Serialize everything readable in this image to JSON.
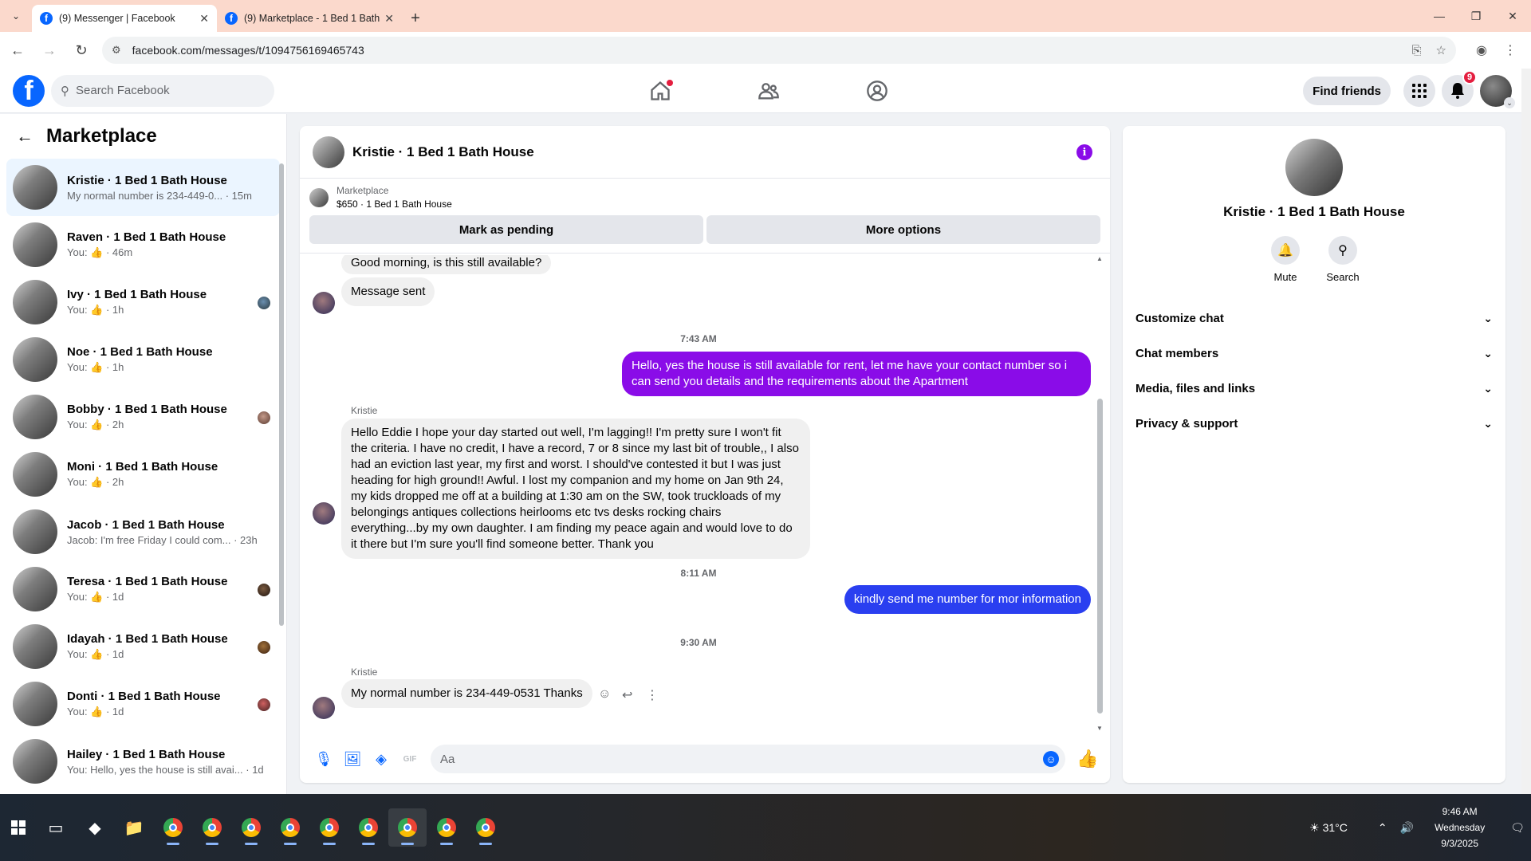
{
  "browser": {
    "tabs": [
      {
        "title": "(9) Messenger | Facebook",
        "active": true
      },
      {
        "title": "(9) Marketplace - 1 Bed 1 Bath",
        "active": false
      }
    ],
    "url": "facebook.com/messages/t/1094756169465743"
  },
  "fb": {
    "search_placeholder": "Search Facebook",
    "find_friends": "Find friends",
    "notif_count": "9"
  },
  "sidebar": {
    "title": "Marketplace",
    "conversations": [
      {
        "name": "Kristie · 1 Bed 1 Bath House",
        "preview": "My normal number is 234-449-0... · 15m",
        "active": true
      },
      {
        "name": "Raven · 1 Bed 1 Bath House",
        "you": "You: ",
        "suffix": " · 46m"
      },
      {
        "name": "Ivy · 1 Bed 1 Bath House",
        "you": "You: ",
        "suffix": " · 1h"
      },
      {
        "name": "Noe · 1 Bed 1 Bath House",
        "you": "You: ",
        "suffix": " · 1h"
      },
      {
        "name": "Bobby · 1 Bed 1 Bath House",
        "you": "You: ",
        "suffix": " · 2h"
      },
      {
        "name": "Moni · 1 Bed 1 Bath House",
        "you": "You: ",
        "suffix": " · 2h"
      },
      {
        "name": "Jacob · 1 Bed 1 Bath House",
        "preview": "Jacob: I'm free Friday I could com... · 23h"
      },
      {
        "name": "Teresa · 1 Bed 1 Bath House",
        "you": "You: ",
        "suffix": " · 1d"
      },
      {
        "name": "Idayah · 1 Bed 1 Bath House",
        "you": "You: ",
        "suffix": " · 1d"
      },
      {
        "name": "Donti · 1 Bed 1 Bath House",
        "you": "You: ",
        "suffix": " · 1d"
      },
      {
        "name": "Hailey · 1 Bed 1 Bath House",
        "preview": "You: Hello, yes the house is still avai... · 1d"
      }
    ]
  },
  "chat": {
    "title": "Kristie · 1 Bed 1 Bath House",
    "marketplace_label": "Marketplace",
    "listing": "$650 · 1 Bed 1 Bath House",
    "mark_pending": "Mark as pending",
    "more_options": "More options",
    "messages": {
      "m1": "Good morning, is this still available?",
      "m2": "Message sent",
      "ts1": "7:43 AM",
      "m3": "Hello, yes the house is still available for rent, let me have your contact number so i can send you details and the requirements about the  Apartment",
      "sender1": "Kristie",
      "m4": "Hello Eddie I hope your day started out well, I'm lagging!! I'm pretty sure I won't fit the criteria. I have no credit, I have a record, 7 or 8 since my last bit of trouble,, I also had an eviction last year, my first and worst. I should've contested it but I was just heading for high ground!! Awful. I lost my companion and my home on Jan 9th 24, my kids dropped me off at a building at 1:30 am on the SW, took truckloads of my belongings antiques collections heirlooms etc tvs desks rocking chairs everything...by my own daughter. I am finding my peace again and would love to do it there but I'm sure you'll find someone better. Thank you",
      "ts2": "8:11 AM",
      "m5": "kindly send me number for mor information",
      "ts3": "9:30 AM",
      "sender2": "Kristie",
      "m6": "My normal number is 234-449-0531 Thanks"
    },
    "composer_placeholder": "Aa"
  },
  "info": {
    "name": "Kristie · 1 Bed 1 Bath House",
    "mute": "Mute",
    "search": "Search",
    "sections": [
      "Customize chat",
      "Chat members",
      "Media, files and links",
      "Privacy & support"
    ]
  },
  "taskbar": {
    "weather": "31°C",
    "time": "9:46 AM",
    "day": "Wednesday",
    "date": "9/3/2025"
  },
  "colors": {
    "fb_blue": "#0866ff",
    "outgoing_purple": "#8a0ce8",
    "outgoing_blue": "#2a3ff0",
    "tab_strip": "#fbd9cc"
  }
}
